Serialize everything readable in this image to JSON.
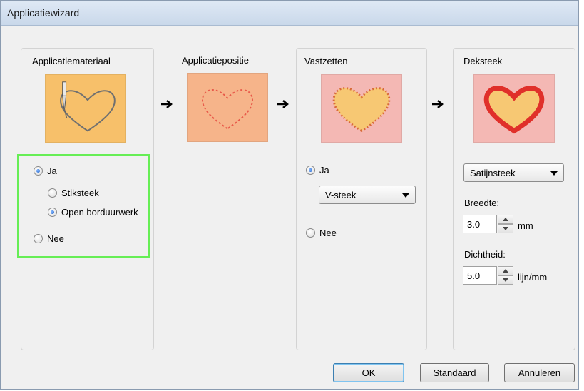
{
  "window": {
    "title": "Applicatiewizard"
  },
  "panels": {
    "material": {
      "title": "Applicatiemateriaal",
      "ja_label": "Ja",
      "stiksteek_label": "Stiksteek",
      "open_label": "Open borduurwerk",
      "nee_label": "Nee",
      "selected": "Ja",
      "sub_selected": "Open borduurwerk"
    },
    "position": {
      "title": "Applicatiepositie"
    },
    "fixing": {
      "title": "Vastzetten",
      "ja_label": "Ja",
      "nee_label": "Nee",
      "selected": "Ja",
      "stitch_value": "V-steek"
    },
    "cover": {
      "title": "Deksteek",
      "stitch_value": "Satijnsteek",
      "width_label": "Breedte:",
      "width_value": "3.0",
      "width_unit": "mm",
      "density_label": "Dichtheid:",
      "density_value": "5.0",
      "density_unit": "lijn/mm"
    }
  },
  "buttons": {
    "ok": "OK",
    "standaard": "Standaard",
    "annuleren": "Annuleren"
  },
  "icons": [
    "needle-icon",
    "arrow-right-icon",
    "dropdown-caret-icon",
    "spin-up-icon",
    "spin-down-icon"
  ],
  "colors": {
    "material_bg": "#f7c06a",
    "position_bg": "#f6b48a",
    "fixing_bg": "#f4b8b4",
    "cover_bg": "#f4b8b4",
    "highlight": "#66ee55"
  }
}
